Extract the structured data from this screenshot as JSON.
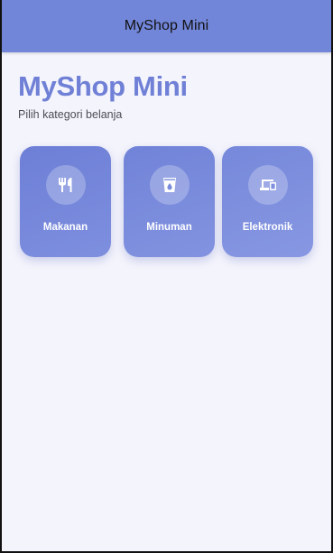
{
  "appbar": {
    "title": "MyShop Mini"
  },
  "main": {
    "title": "MyShop Mini",
    "subtitle": "Pilih kategori belanja",
    "categories": [
      {
        "label": "Makanan",
        "icon": "restaurant-icon"
      },
      {
        "label": "Minuman",
        "icon": "drink-icon"
      },
      {
        "label": "Elektronik",
        "icon": "devices-icon"
      }
    ]
  },
  "colors": {
    "appbar_bg": "#7286d9",
    "accent": "#6f80d6",
    "card_bg": "#7485d9",
    "page_bg": "#f4f4fc"
  }
}
